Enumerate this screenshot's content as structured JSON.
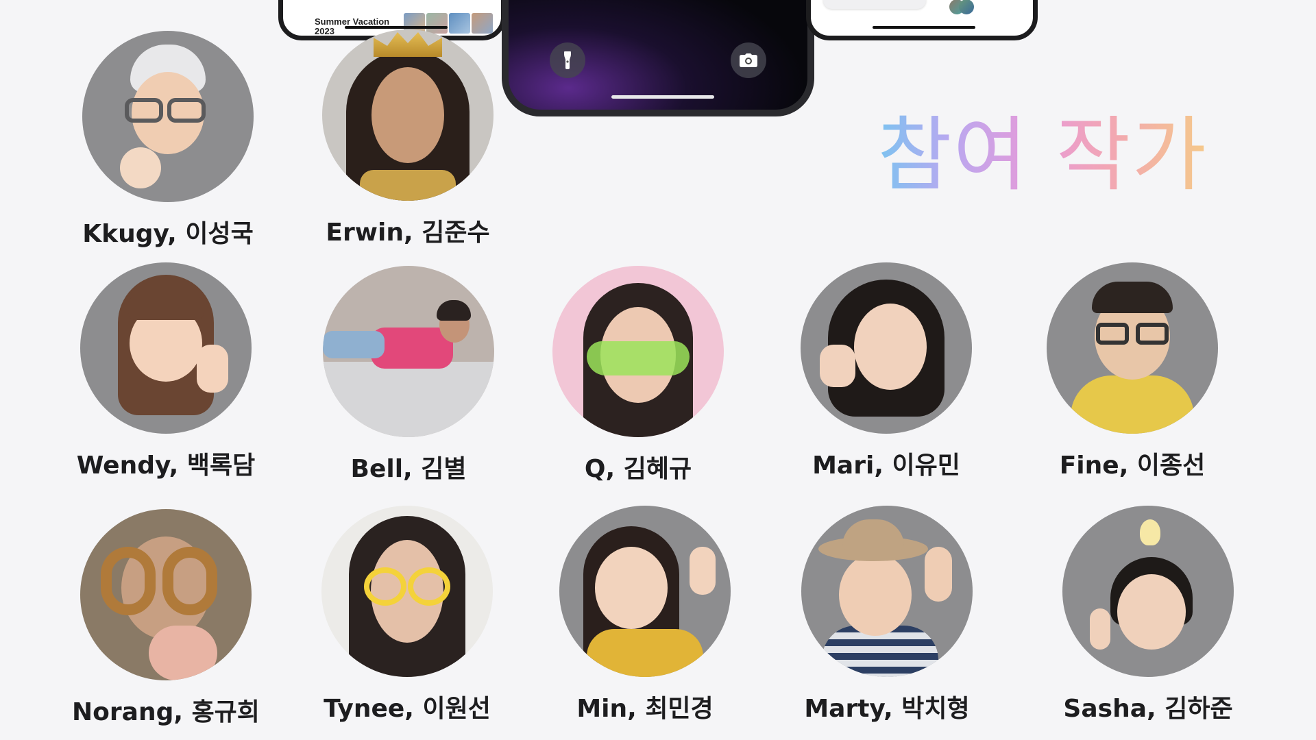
{
  "phones": {
    "left": {
      "caption": "Summer Vacation\n2023"
    },
    "center": {
      "flashlight_icon": "flashlight-icon",
      "camera_icon": "camera-icon"
    },
    "right": {}
  },
  "headline": "참여 작가",
  "colors": {
    "background": "#f5f5f7",
    "memoji_bg": "#8d8d8f",
    "headline_gradient": [
      "#7cc3f0",
      "#b9a8f0",
      "#e79ad8",
      "#f2a6b4",
      "#f5c98a"
    ]
  },
  "artists": [
    {
      "name": "Kkugy, 이성국",
      "type": "memoji"
    },
    {
      "name": "Erwin, 김준수",
      "type": "photo"
    },
    {
      "name": "Wendy, 백록담",
      "type": "memoji"
    },
    {
      "name": "Bell, 김별",
      "type": "photo"
    },
    {
      "name": "Q, 김혜규",
      "type": "photo"
    },
    {
      "name": "Mari, 이유민",
      "type": "memoji"
    },
    {
      "name": "Fine, 이종선",
      "type": "memoji"
    },
    {
      "name": "Norang,  홍규희",
      "type": "photo"
    },
    {
      "name": "Tynee, 이원선",
      "type": "photo"
    },
    {
      "name": "Min, 최민경",
      "type": "memoji"
    },
    {
      "name": "Marty, 박치형",
      "type": "memoji"
    },
    {
      "name": "Sasha, 김하준",
      "type": "memoji"
    }
  ]
}
